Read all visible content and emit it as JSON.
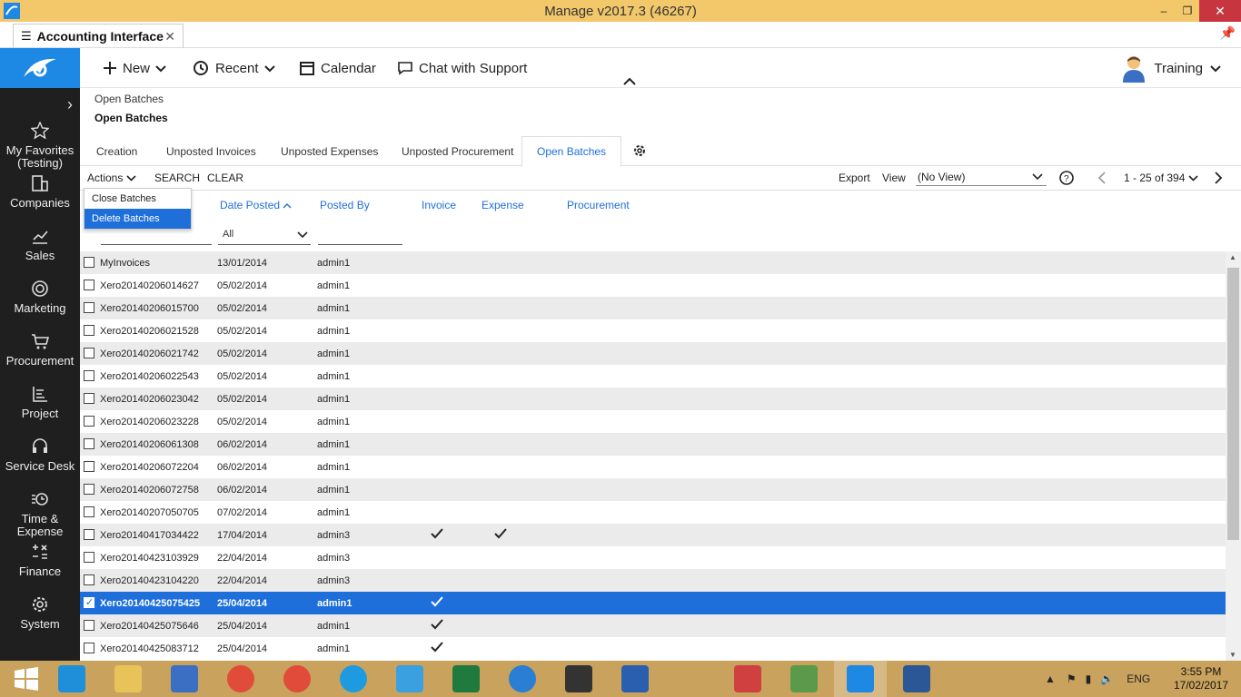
{
  "window": {
    "title": "Manage v2017.3 (46267)",
    "minimize": "–",
    "maximize": "❐",
    "close": "✕"
  },
  "doc_tab": {
    "label": "Accounting Interface",
    "close": "✕"
  },
  "sidebar": {
    "items": [
      {
        "label": "My Favorites (Testing)",
        "icon": "star-icon"
      },
      {
        "label": "Companies",
        "icon": "building-icon"
      },
      {
        "label": "Sales",
        "icon": "chart-icon"
      },
      {
        "label": "Marketing",
        "icon": "target-icon"
      },
      {
        "label": "Procurement",
        "icon": "cart-icon"
      },
      {
        "label": "Project",
        "icon": "project-icon"
      },
      {
        "label": "Service Desk",
        "icon": "headset-icon"
      },
      {
        "label": "Time & Expense",
        "icon": "time-expense-icon"
      },
      {
        "label": "Finance",
        "icon": "finance-icon"
      },
      {
        "label": "System",
        "icon": "gear-icon"
      }
    ]
  },
  "toolbar": {
    "new": "New",
    "recent": "Recent",
    "calendar": "Calendar",
    "chat": "Chat with Support",
    "user": "Training"
  },
  "breadcrumb": {
    "parent": "Open Batches",
    "current": "Open Batches"
  },
  "tabs": [
    "Creation",
    "Unposted Invoices",
    "Unposted Expenses",
    "Unposted Procurement",
    "Open Batches"
  ],
  "actionbar": {
    "actions": "Actions",
    "search": "SEARCH",
    "clear": "CLEAR",
    "export": "Export",
    "view": "View",
    "view_value": "(No View)",
    "paging": "1 - 25 of 394"
  },
  "menu": {
    "items": [
      "Close Batches",
      "Delete Batches"
    ]
  },
  "columns": {
    "date_posted": "Date Posted",
    "posted_by": "Posted By",
    "invoice": "Invoice",
    "expense": "Expense",
    "procurement": "Procurement"
  },
  "filter": {
    "date_value": "All"
  },
  "rows": [
    {
      "name": "MyInvoices",
      "date": "13/01/2014",
      "by": "admin1",
      "inv": false,
      "exp": false,
      "checked": false
    },
    {
      "name": "Xero20140206014627",
      "date": "05/02/2014",
      "by": "admin1",
      "inv": false,
      "exp": false,
      "checked": false
    },
    {
      "name": "Xero20140206015700",
      "date": "05/02/2014",
      "by": "admin1",
      "inv": false,
      "exp": false,
      "checked": false
    },
    {
      "name": "Xero20140206021528",
      "date": "05/02/2014",
      "by": "admin1",
      "inv": false,
      "exp": false,
      "checked": false
    },
    {
      "name": "Xero20140206021742",
      "date": "05/02/2014",
      "by": "admin1",
      "inv": false,
      "exp": false,
      "checked": false
    },
    {
      "name": "Xero20140206022543",
      "date": "05/02/2014",
      "by": "admin1",
      "inv": false,
      "exp": false,
      "checked": false
    },
    {
      "name": "Xero20140206023042",
      "date": "05/02/2014",
      "by": "admin1",
      "inv": false,
      "exp": false,
      "checked": false
    },
    {
      "name": "Xero20140206023228",
      "date": "05/02/2014",
      "by": "admin1",
      "inv": false,
      "exp": false,
      "checked": false
    },
    {
      "name": "Xero20140206061308",
      "date": "06/02/2014",
      "by": "admin1",
      "inv": false,
      "exp": false,
      "checked": false
    },
    {
      "name": "Xero20140206072204",
      "date": "06/02/2014",
      "by": "admin1",
      "inv": false,
      "exp": false,
      "checked": false
    },
    {
      "name": "Xero20140206072758",
      "date": "06/02/2014",
      "by": "admin1",
      "inv": false,
      "exp": false,
      "checked": false
    },
    {
      "name": "Xero20140207050705",
      "date": "07/02/2014",
      "by": "admin1",
      "inv": false,
      "exp": false,
      "checked": false
    },
    {
      "name": "Xero20140417034422",
      "date": "17/04/2014",
      "by": "admin3",
      "inv": true,
      "exp": true,
      "checked": false
    },
    {
      "name": "Xero20140423103929",
      "date": "22/04/2014",
      "by": "admin3",
      "inv": false,
      "exp": false,
      "checked": false
    },
    {
      "name": "Xero20140423104220",
      "date": "22/04/2014",
      "by": "admin3",
      "inv": false,
      "exp": false,
      "checked": false
    },
    {
      "name": "Xero20140425075425",
      "date": "25/04/2014",
      "by": "admin1",
      "inv": true,
      "exp": false,
      "checked": true
    },
    {
      "name": "Xero20140425075646",
      "date": "25/04/2014",
      "by": "admin1",
      "inv": true,
      "exp": false,
      "checked": false
    },
    {
      "name": "Xero20140425083712",
      "date": "25/04/2014",
      "by": "admin1",
      "inv": true,
      "exp": false,
      "checked": false
    }
  ],
  "taskbar": {
    "apps": [
      "start-icon",
      "ie-icon",
      "explorer-icon",
      "remote-desktop-icon",
      "chrome-icon",
      "chrome-profile-icon",
      "skype-icon",
      "wifi-app-icon",
      "excel-icon",
      "chat-app-icon",
      "vpn-icon",
      "lock-app-icon",
      "tools-icon",
      "snipping-icon",
      "chart-app-icon",
      "manage-app-icon",
      "word-icon"
    ],
    "lang": "ENG",
    "time": "3:55 PM",
    "date": "17/02/2017"
  },
  "colors": {
    "accent": "#1e6fd9",
    "sidebar": "#1f1f1f",
    "titlebar": "#f3c86b",
    "taskbar": "#c9a25d"
  }
}
